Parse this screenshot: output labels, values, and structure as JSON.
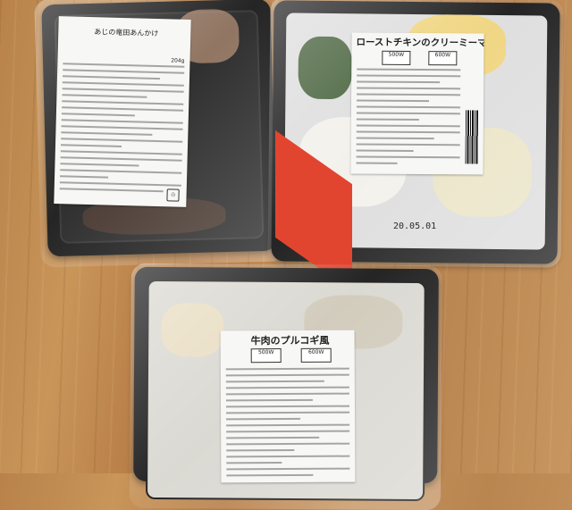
{
  "photo": {
    "description_tags": [
      "wood-table",
      "packaged-meals",
      "plastic-trays"
    ]
  },
  "trays": [
    {
      "label_title": "あじの竜田あんかけ",
      "weight": "204g"
    },
    {
      "label_title": "ローストチキンのクリーミーマヨソース",
      "watt_a": "500W",
      "watt_b": "600W",
      "date": "20.05.01"
    },
    {
      "label_title": "牛肉のプルコギ風",
      "watt_a": "500W",
      "watt_b": "600W"
    }
  ],
  "colors": {
    "tray": "#121212",
    "red_band": "#e2452f",
    "label_paper": "#f7f7f5",
    "wood": "#c99559"
  }
}
